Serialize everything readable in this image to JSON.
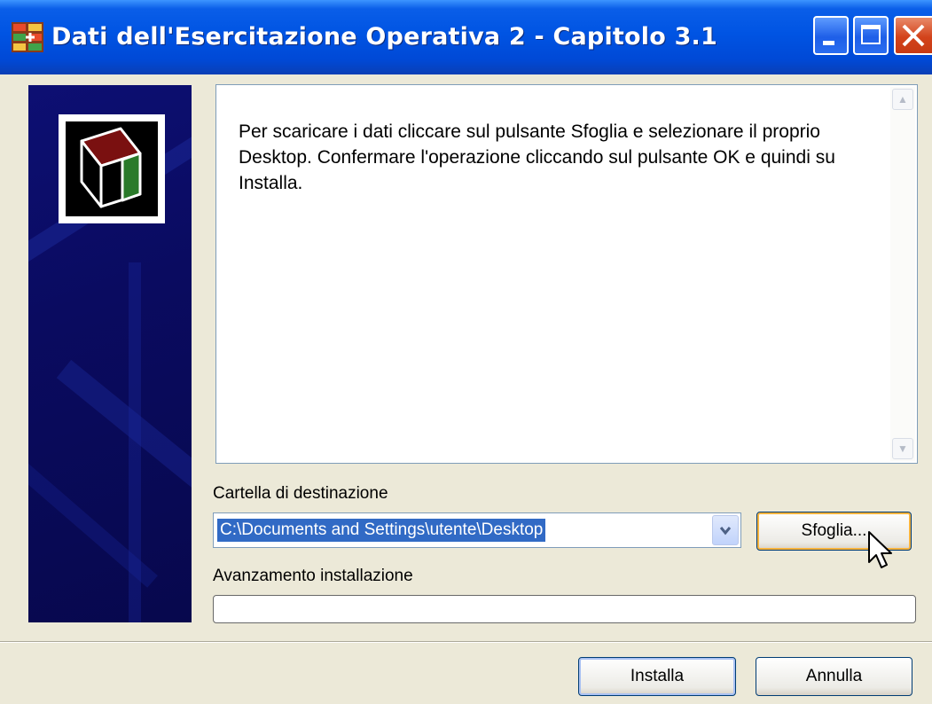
{
  "window": {
    "title": "Dati dell'Esercitazione Operativa 2 - Capitolo 3.1"
  },
  "instructions": {
    "text": "Per scaricare i dati cliccare sul pulsante Sfoglia e selezionare il proprio Desktop. Confermare l'operazione cliccando sul pulsante OK e quindi su Installa."
  },
  "destination": {
    "label": "Cartella di destinazione",
    "value": "C:\\Documents and Settings\\utente\\Desktop",
    "browse_label": "Sfoglia..."
  },
  "progress": {
    "label": "Avanzamento installazione",
    "value": 0
  },
  "footer": {
    "install_label": "Installa",
    "cancel_label": "Annulla"
  },
  "colors": {
    "titlebar": "#0054e3",
    "side_panel": "#0a0b60",
    "selection": "#316ac5",
    "dialog_bg": "#ece9d8"
  }
}
